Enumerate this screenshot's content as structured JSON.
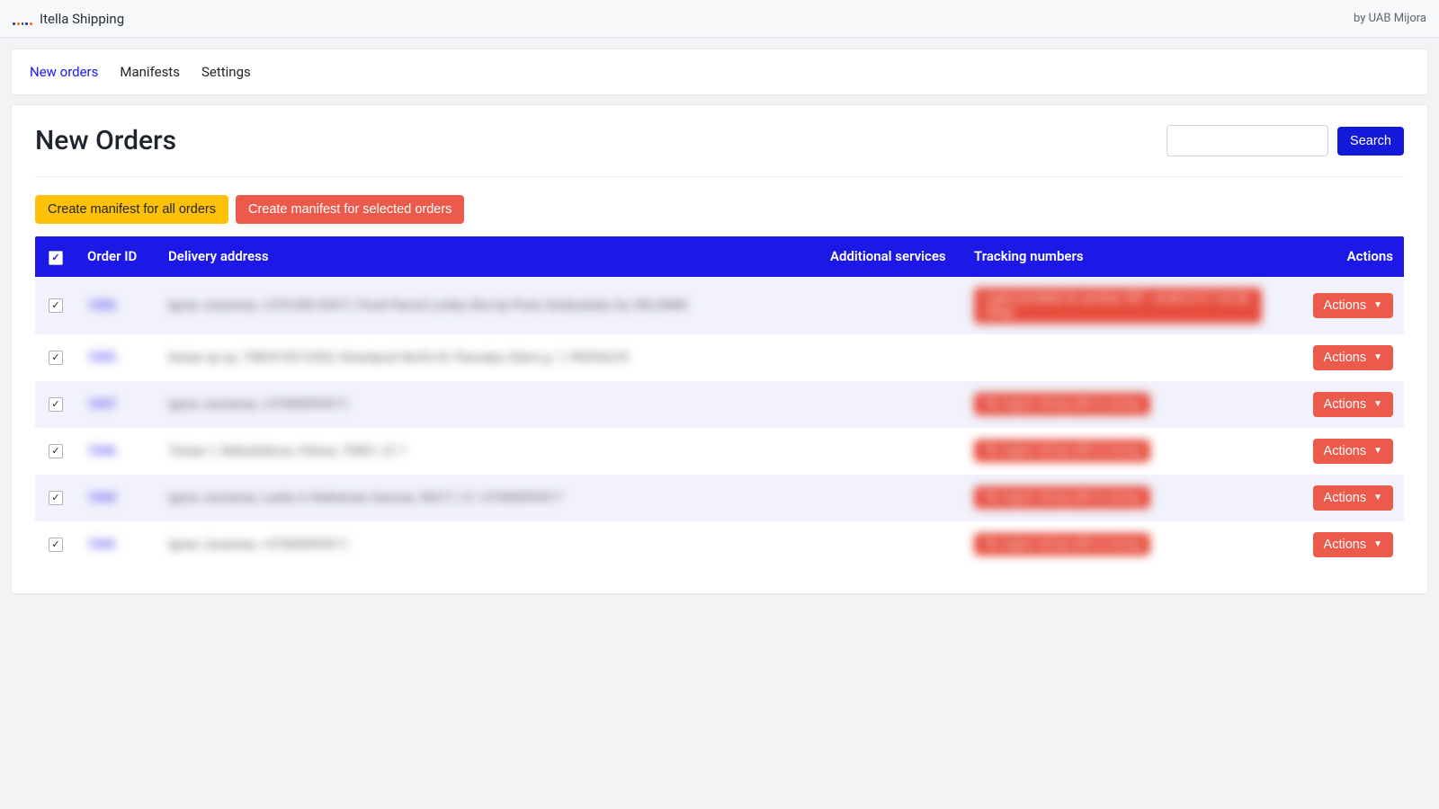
{
  "header": {
    "brand": "Itella Shipping",
    "byline": "by UAB Mijora"
  },
  "tabs": [
    {
      "label": "New orders",
      "active": true
    },
    {
      "label": "Manifests",
      "active": false
    },
    {
      "label": "Settings",
      "active": false
    }
  ],
  "page": {
    "title": "New Orders",
    "search_value": "",
    "search_btn": "Search"
  },
  "actions": {
    "create_all": "Create manifest for all orders",
    "create_selected": "Create manifest for selected orders",
    "row_action_label": "Actions"
  },
  "table": {
    "headers": {
      "order_id": "Order ID",
      "delivery": "Delivery address",
      "services": "Additional services",
      "tracking": "Tracking numbers",
      "actions": "Actions"
    },
    "rows": [
      {
        "id": "1056",
        "address": "Ignas Juozenas, +370 600 93417, Posti Parcel Locker, Box by Posti, Keskuskatu 3a, HELSINKI",
        "services": "",
        "tracking": "Label printable for another 287 - small to 0.1 m3 (& 35kg)",
        "tracking_style": "long",
        "checked": true
      },
      {
        "id": "1055",
        "address": "testas sp sp, 1982410212332, Smartpost Norfa XL Pasvalys, Ežero g. 1, PASVALYS",
        "services": "",
        "tracking": "",
        "checked": true
      },
      {
        "id": "1047",
        "address": "Ignas Juozenas, +37060093417,",
        "services": "",
        "tracking": "No region string with is wrong",
        "tracking_style": "short",
        "checked": true
      },
      {
        "id": "1046",
        "address": "Testas 1, Baltušiskova, Vilnius, 70401, LT, 1",
        "services": "",
        "tracking": "No region string with is wrong",
        "tracking_style": "short",
        "checked": true
      },
      {
        "id": "1045",
        "address": "Ignas Juozenas, Laulio 4, Raštainiai, Kaunas, 50217, LT, +37060093417",
        "services": "",
        "tracking": "No region string with is wrong",
        "tracking_style": "short",
        "checked": true
      },
      {
        "id": "1042",
        "address": "Ignas Juozenas, +37060093417,",
        "services": "",
        "tracking": "No region string with is wrong",
        "tracking_style": "short",
        "checked": true
      }
    ]
  }
}
